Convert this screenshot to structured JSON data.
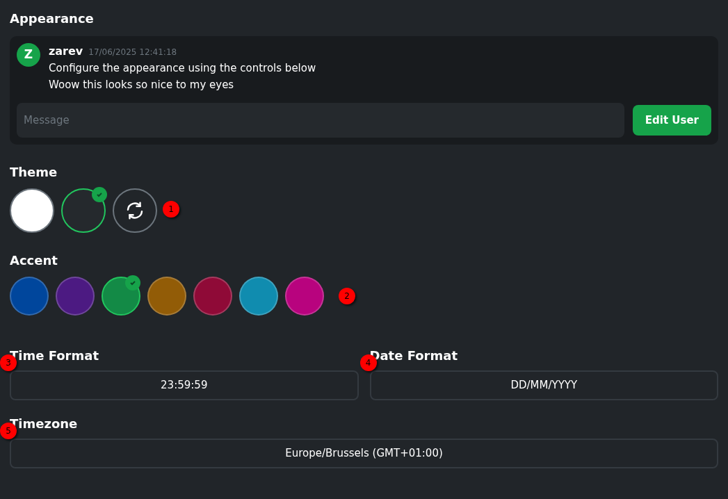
{
  "title": "Appearance",
  "preview": {
    "avatar": "Z",
    "username": "zarev",
    "timestamp": "17/06/2025 12:41:18",
    "lines": [
      "Configure the appearance using the controls below",
      "Woow this looks so nice to my eyes"
    ],
    "message_placeholder": "Message",
    "button": "Edit User"
  },
  "theme": {
    "label": "Theme",
    "marker": "1",
    "options": [
      {
        "kind": "light",
        "selected": false
      },
      {
        "kind": "dark",
        "selected": true
      },
      {
        "kind": "auto",
        "selected": false
      }
    ]
  },
  "accent": {
    "label": "Accent",
    "marker": "2",
    "options": [
      {
        "color": "#00469c",
        "selected": false
      },
      {
        "color": "#4c1a82",
        "selected": false
      },
      {
        "color": "#138a46",
        "selected": true
      },
      {
        "color": "#925c07",
        "selected": false
      },
      {
        "color": "#8f0a37",
        "selected": false
      },
      {
        "color": "#108caf",
        "selected": false
      },
      {
        "color": "#b8037e",
        "selected": false
      }
    ]
  },
  "time_format": {
    "label": "Time Format",
    "marker": "3",
    "value": "23:59:59"
  },
  "date_format": {
    "label": "Date Format",
    "marker": "4",
    "value": "DD/MM/YYYY"
  },
  "timezone": {
    "label": "Timezone",
    "marker": "5",
    "value": "Europe/Brussels (GMT+01:00)"
  }
}
